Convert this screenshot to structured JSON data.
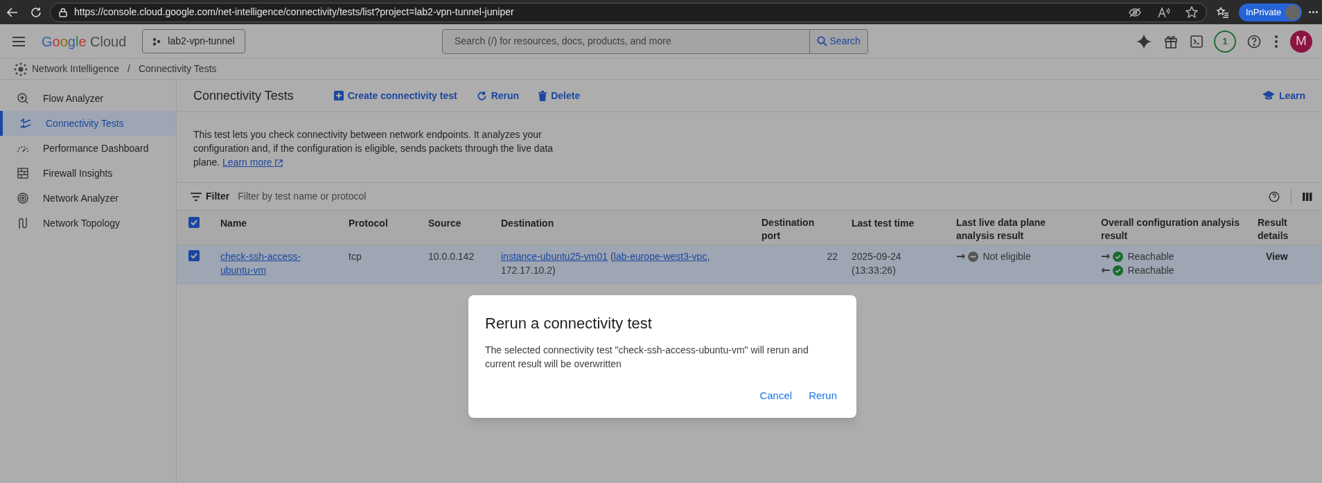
{
  "browser": {
    "url": "https://console.cloud.google.com/net-intelligence/connectivity/tests/list?project=lab2-vpn-tunnel-juniper",
    "inprivate_label": "InPrivate"
  },
  "header": {
    "logo_text": "Google Cloud",
    "project": "lab2-vpn-tunnel",
    "search_placeholder": "Search (/) for resources, docs, products, and more",
    "search_button": "Search",
    "notifications_count": "1",
    "avatar_letter": "M"
  },
  "breadcrumb": {
    "separator": "/",
    "items": [
      "Network Intelligence",
      "Connectivity Tests"
    ]
  },
  "sidebar": {
    "items": [
      {
        "label": "Flow Analyzer",
        "selected": false
      },
      {
        "label": "Connectivity Tests",
        "selected": true
      },
      {
        "label": "Performance Dashboard",
        "selected": false
      },
      {
        "label": "Firewall Insights",
        "selected": false
      },
      {
        "label": "Network Analyzer",
        "selected": false
      },
      {
        "label": "Network Topology",
        "selected": false
      }
    ]
  },
  "page": {
    "title": "Connectivity Tests",
    "actions": [
      "Create connectivity test",
      "Rerun",
      "Delete"
    ],
    "learn": "Learn"
  },
  "description": {
    "text": "This test lets you check connectivity between network endpoints. It analyzes your configuration and, if the configuration is eligible, sends packets through the live data plane.",
    "link": "Learn more"
  },
  "filter": {
    "label": "Filter",
    "placeholder": "Filter by test name or protocol"
  },
  "table": {
    "all_selected": true,
    "columns": [
      "Name",
      "Protocol",
      "Source",
      "Destination",
      "Destination port",
      "Last test time",
      "Last live data plane analysis result",
      "Overall configuration analysis result",
      "Result details"
    ],
    "rows": [
      {
        "selected": true,
        "name": "check-ssh-access-ubuntu-vm",
        "protocol": "tcp",
        "source": "10.0.0.142",
        "destination": {
          "instance": "instance-ubuntu25-vm01",
          "open": "(",
          "network": "lab-europe-west3-vpc",
          "comma": ",",
          "ip": "172.17.10.2)"
        },
        "port": "22",
        "last_test_time": [
          "2025-09-24",
          "(13:33:26)"
        ],
        "live_results": [
          {
            "arrow": "→",
            "kind": "not_eligible",
            "status": "Not eligible"
          }
        ],
        "config_results": [
          {
            "arrow": "→",
            "kind": "reachable",
            "status": "Reachable"
          },
          {
            "arrow": "←",
            "kind": "reachable",
            "status": "Reachable"
          }
        ],
        "details": "View"
      }
    ]
  },
  "dialog": {
    "title": "Rerun a connectivity test",
    "message": "The selected connectivity test \"check-ssh-access-ubuntu-vm\" will rerun and current result will be overwritten",
    "buttons": [
      "Cancel",
      "Rerun"
    ]
  }
}
